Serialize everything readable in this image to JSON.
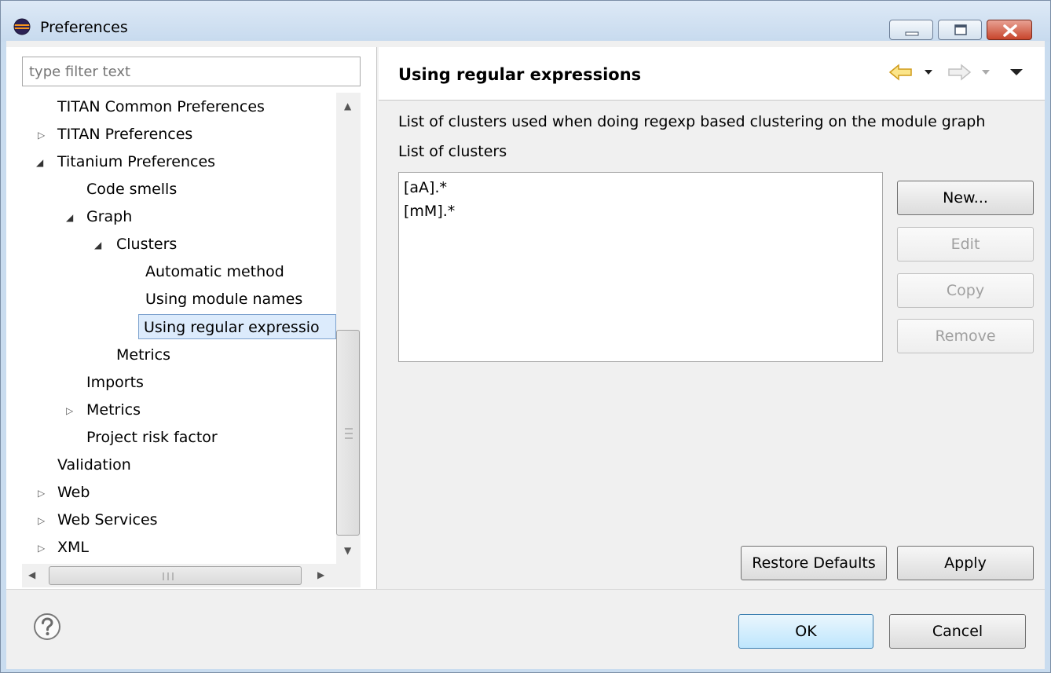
{
  "window": {
    "title": "Preferences"
  },
  "filter": {
    "placeholder": "type filter text"
  },
  "tree": {
    "items": [
      {
        "label": "TITAN Common Preferences"
      },
      {
        "label": "TITAN Preferences"
      },
      {
        "label": "Titanium Preferences"
      },
      {
        "label": "Code smells"
      },
      {
        "label": "Graph"
      },
      {
        "label": "Clusters"
      },
      {
        "label": "Automatic method"
      },
      {
        "label": "Using module names"
      },
      {
        "label": "Using regular expressio"
      },
      {
        "label": "Metrics"
      },
      {
        "label": "Imports"
      },
      {
        "label": "Metrics"
      },
      {
        "label": "Project risk factor"
      },
      {
        "label": "Validation"
      },
      {
        "label": "Web"
      },
      {
        "label": "Web Services"
      },
      {
        "label": "XML"
      }
    ]
  },
  "page": {
    "title": "Using regular expressions",
    "description": "List of clusters used when doing regexp based clustering on the module graph",
    "list_label": "List of clusters",
    "clusters": [
      "[aA].*",
      "[mM].*"
    ]
  },
  "buttons": {
    "new": "New...",
    "edit": "Edit",
    "copy": "Copy",
    "remove": "Remove",
    "restore_defaults": "Restore Defaults",
    "apply": "Apply",
    "ok": "OK",
    "cancel": "Cancel"
  },
  "icons": {
    "app": "eclipse-icon",
    "help": "help-icon",
    "back": "back-arrow-icon",
    "forward": "forward-arrow-icon",
    "menu": "view-menu-icon"
  },
  "colors": {
    "selection": "#dcebfc",
    "back_arrow": "#e8b92a"
  }
}
